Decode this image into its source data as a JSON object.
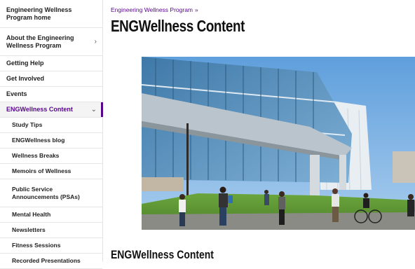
{
  "sidebar": {
    "items": [
      {
        "label": "Engineering Wellness Program home",
        "chevron": false,
        "active": false
      },
      {
        "label": "About the Engineering Wellness Program",
        "chevron": true,
        "active": false
      },
      {
        "label": "Getting Help",
        "chevron": false,
        "active": false
      },
      {
        "label": "Get Involved",
        "chevron": false,
        "active": false
      },
      {
        "label": "Events",
        "chevron": false,
        "active": false
      },
      {
        "label": "ENGWellness Content",
        "chevron": true,
        "active": true
      }
    ],
    "subitems": [
      {
        "label": "Study Tips"
      },
      {
        "label": "ENGWellness blog"
      },
      {
        "label": "Wellness Breaks"
      },
      {
        "label": "Memoirs of Wellness"
      },
      {
        "label": "Public Service Announcements (PSAs)"
      },
      {
        "label": "Mental Health"
      },
      {
        "label": "Newsletters"
      },
      {
        "label": "Fitness Sessions"
      },
      {
        "label": "Recorded Presentations"
      }
    ],
    "icons": {
      "chevron_right": "chevron-right-icon",
      "chevron_down": "chevron-down-icon"
    },
    "accent_color": "#57068c"
  },
  "breadcrumb": {
    "link": "Engineering Wellness Program",
    "separator": "»"
  },
  "main": {
    "title": "ENGWellness Content",
    "section_title": "ENGWellness Content"
  }
}
